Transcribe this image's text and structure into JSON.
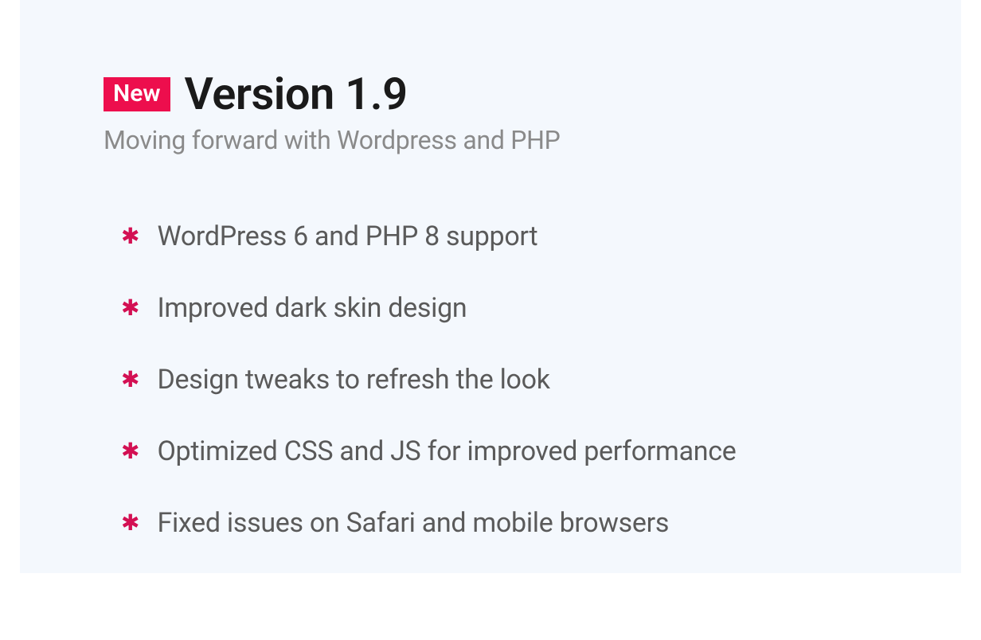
{
  "badge": "New",
  "title": "Version 1.9",
  "subtitle": "Moving forward with Wordpress and PHP",
  "features": [
    "WordPress 6 and PHP 8 support",
    "Improved dark skin design",
    "Design tweaks to refresh the look",
    "Optimized CSS and JS for improved performance",
    "Fixed issues on Safari and mobile browsers"
  ]
}
